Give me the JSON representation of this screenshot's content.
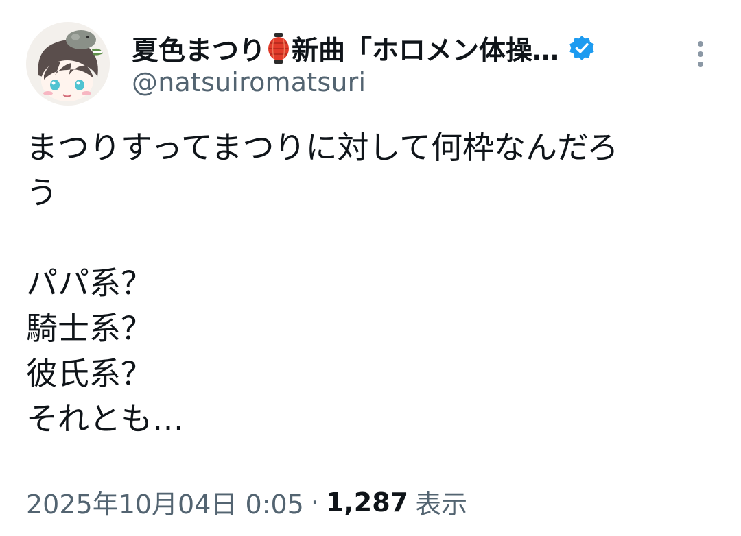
{
  "tweet": {
    "author": {
      "display_name": "夏色まつり",
      "display_name_suffix": "新曲「ホロメン体操…",
      "handle": "@natsuiromatsuri",
      "emoji": "lantern-icon",
      "verified": true,
      "verified_color": "#1d9bf0"
    },
    "body_lines": [
      "まつりすってまつりに対して何枠なんだろ",
      "う",
      "",
      "パパ系？",
      "騎士系？",
      "彼氏系？",
      "それとも…"
    ],
    "timestamp": "2025年10月04日 0:05",
    "separator": "·",
    "views_count": "1,287",
    "views_label": "表示"
  },
  "colors": {
    "text_primary": "#0f1419",
    "text_secondary": "#536471",
    "accent": "#1d9bf0"
  }
}
